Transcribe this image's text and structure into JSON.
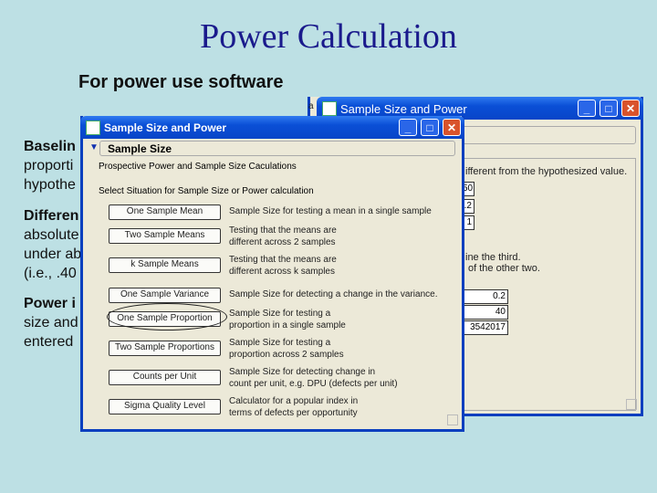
{
  "slide": {
    "title": "Power Calculation",
    "subtitle": "For power use software",
    "lines": [
      "Baselin",
      "proporti",
      "hypothe",
      "Differen",
      "absolute",
      "under ab",
      "(i.e., .40",
      "Power i",
      "size and",
      "entered"
    ]
  },
  "back_window": {
    "title": "Sample Size and Power",
    "fragment": "a",
    "texts": [
      "ifferent from the hypothesized value.",
      "ine the third.",
      "of the other two."
    ],
    "fields_top": [
      "50",
      ".2",
      "1"
    ],
    "fields": [
      "0.2",
      "40",
      "3542017"
    ]
  },
  "front_window": {
    "title": "Sample Size and Power",
    "section": "Sample Size",
    "heading": "Prospective Power and Sample Size Caculations",
    "prompt": "Select Situation for Sample Size or Power calculation",
    "options": [
      {
        "label": "One Sample Mean",
        "desc": [
          "Sample Size for testing a mean in a single sample"
        ]
      },
      {
        "label": "Two Sample Means",
        "desc": [
          "Testing that the means are",
          "different across 2 samples"
        ]
      },
      {
        "label": "k Sample Means",
        "desc": [
          "Testing that the means are",
          "different across k samples"
        ]
      },
      {
        "label": "One Sample Variance",
        "desc": [
          "Sample Size for detecting a change in the variance."
        ]
      },
      {
        "label": "One Sample Proportion",
        "desc": [
          "Sample Size for testing a",
          "proportion in a single sample"
        ]
      },
      {
        "label": "Two Sample Proportions",
        "desc": [
          "Sample Size for testing a",
          "proportion across 2 samples"
        ]
      },
      {
        "label": "Counts per Unit",
        "desc": [
          "Sample Size for detecting change in",
          "count per unit, e.g. DPU (defects per unit)"
        ]
      },
      {
        "label": "Sigma Quality Level",
        "desc": [
          "Calculator for a popular index in",
          "terms of defects per opportunity"
        ]
      }
    ]
  }
}
